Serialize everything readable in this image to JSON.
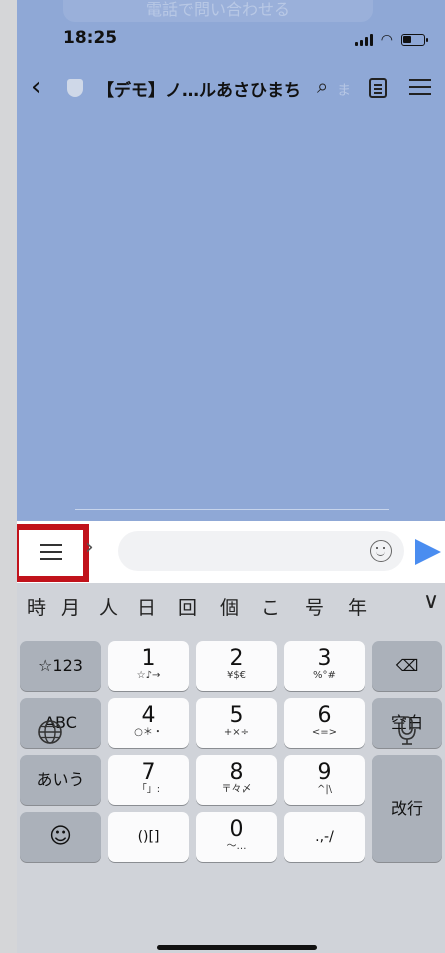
{
  "status_bar": {
    "time": "18:25"
  },
  "ghost_banner": "電話で問い合わせる",
  "nav": {
    "back": "‹",
    "title": "【デモ】ノ…ルあさひまち",
    "search_icon": "⌕",
    "ghost": "ま",
    "menu_icon": "menu-icon"
  },
  "input": {
    "value": "",
    "placeholder": ""
  },
  "keyboard": {
    "candidates": [
      "時",
      "月",
      "人",
      "日",
      "回",
      "個",
      "こ",
      "号",
      "年"
    ],
    "collapse": "∨",
    "keys": {
      "sym": "☆123",
      "abc": "ABC",
      "kana": "あいう",
      "emoji": "☺",
      "k1": "1",
      "k1s": "☆♪→",
      "k2": "2",
      "k2s": "¥$€",
      "k3": "3",
      "k3s": "%°#",
      "k4": "4",
      "k4s": "○＊・",
      "k5": "5",
      "k5s": "+×÷",
      "k6": "6",
      "k6s": "<=>",
      "k7": "7",
      "k7s": "「」:",
      "k8": "8",
      "k8s": "〒々〆",
      "k9": "9",
      "k9s": "^|\\",
      "k0": "0",
      "k0s": "〜…",
      "paren": "()[]",
      "punct": ".,-/",
      "delete": "⌫",
      "space": "空白",
      "enter": "改行"
    },
    "globe": "🌐",
    "mic": "🎙"
  },
  "colors": {
    "chat_bg": "#8fa8d6",
    "highlight": "#c1121b",
    "send": "#4a8df0"
  }
}
